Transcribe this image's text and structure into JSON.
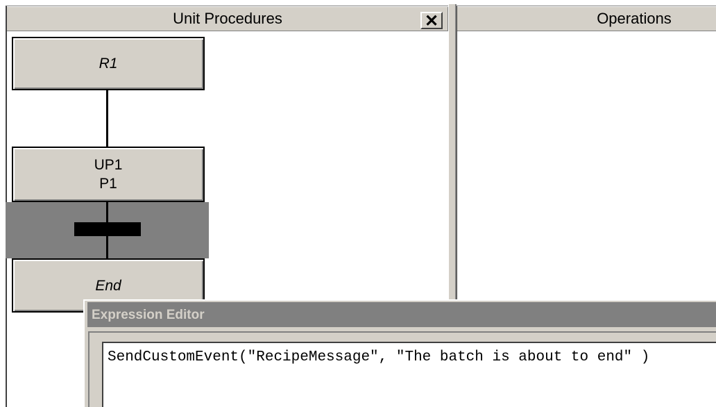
{
  "left_panel": {
    "title": "Unit Procedures",
    "close_glyph": "✕",
    "close_icon": "close-icon"
  },
  "right_panel": {
    "title": "Operations"
  },
  "sfc": {
    "steps": [
      {
        "label": "R1",
        "italic": true
      },
      {
        "line1": "UP1",
        "line2": "P1"
      },
      {
        "label": "End",
        "italic": true
      }
    ],
    "transition_selected": true
  },
  "expression_editor": {
    "title": "Expression Editor",
    "expression": "SendCustomEvent(\"RecipeMessage\", \"The batch is about to end\" )"
  },
  "colors": {
    "chrome": "#d4d0c8",
    "selection": "#808080",
    "shadow": "#404040"
  }
}
